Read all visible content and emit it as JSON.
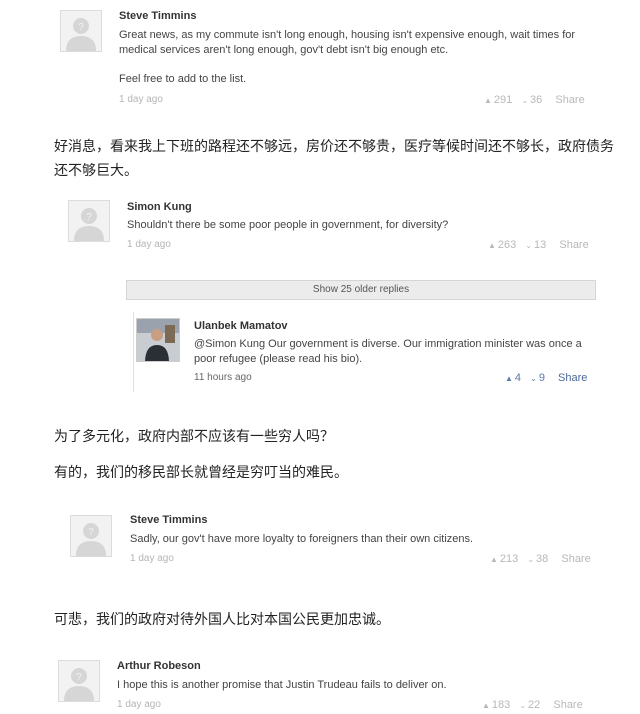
{
  "comments": [
    {
      "author": "Steve Timmins",
      "lines": [
        "Great news, as my commute isn't long enough, housing isn't expensive enough, wait times for medical services aren't long enough, gov't debt isn't big enough etc.",
        "Feel free to add to the list."
      ],
      "time": "1 day ago",
      "up": "291",
      "down": "36",
      "share": "Share"
    },
    {
      "author": "Simon Kung",
      "lines": [
        "Shouldn't there be some poor people in government, for diversity?"
      ],
      "time": "1 day ago",
      "up": "263",
      "down": "13",
      "share": "Share"
    },
    {
      "author": "Ulanbek Mamatov",
      "lines": [
        "@Simon Kung Our government is diverse. Our immigration minister was once a poor refugee (please read his bio)."
      ],
      "time": "11 hours ago",
      "up": "4",
      "down": "9",
      "share": "Share"
    },
    {
      "author": "Steve Timmins",
      "lines": [
        "Sadly, our gov't have more loyalty to foreigners than their own citizens."
      ],
      "time": "1 day ago",
      "up": "213",
      "down": "38",
      "share": "Share"
    },
    {
      "author": "Arthur Robeson",
      "lines": [
        "I hope this is another promise that Justin Trudeau fails to deliver on."
      ],
      "time": "1 day ago",
      "up": "183",
      "down": "22",
      "share": "Share"
    }
  ],
  "older_replies": "Show 25 older replies",
  "translations": [
    "好消息，看来我上下班的路程还不够远，房价还不够贵，医疗等候时间还不够长，政府债务还不够巨大。",
    "为了多元化，政府内部不应该有一些穷人吗？",
    "有的，我们的移民部长就曾经是穷叮当的难民。",
    "可悲，我们的政府对待外国人比对本国公民更加忠诚。"
  ],
  "icons": {
    "upvote": "up-triangle-icon",
    "downvote": "down-chevron-icon",
    "default_avatar": "default-avatar-icon"
  }
}
